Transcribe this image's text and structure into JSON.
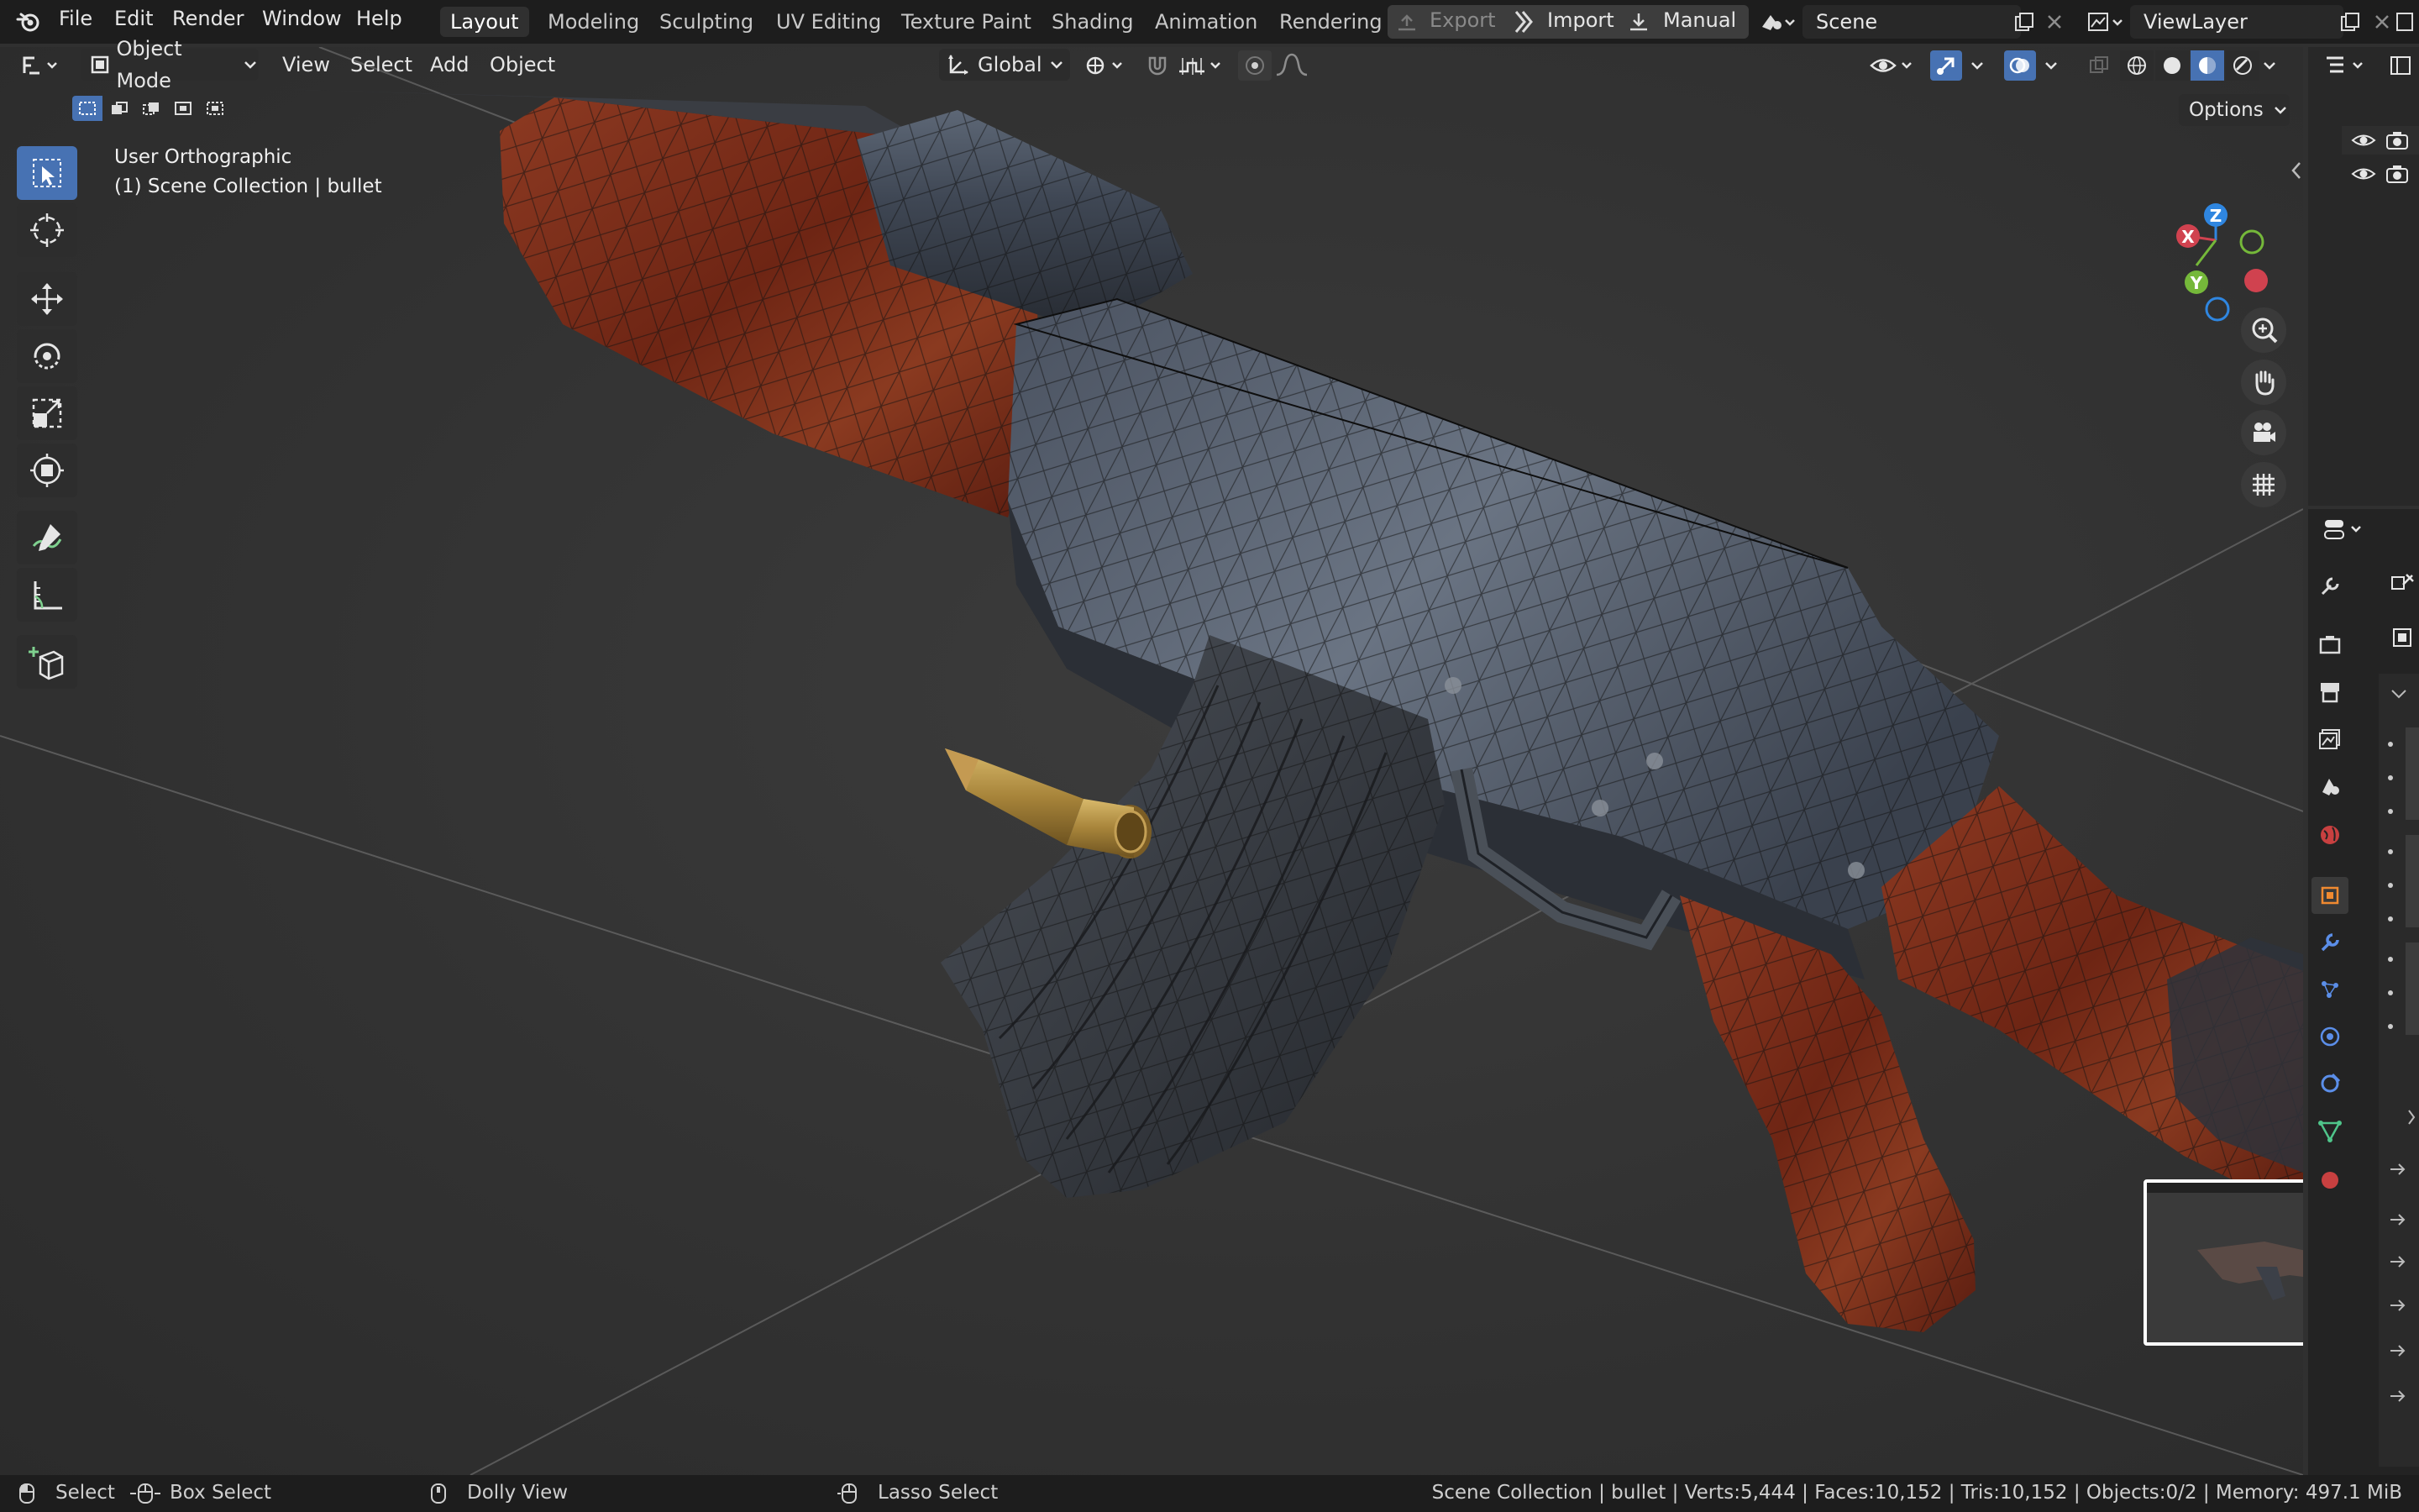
{
  "topbar": {
    "menus": [
      "File",
      "Edit",
      "Render",
      "Window",
      "Help"
    ],
    "workspaces": [
      "Layout",
      "Modeling",
      "Sculpting",
      "UV Editing",
      "Texture Paint",
      "Shading",
      "Animation",
      "Rendering"
    ],
    "active_workspace": "Layout",
    "export_label": "Export",
    "import_label": "Import",
    "manual_label": "Manual",
    "scene_name": "Scene",
    "view_layer_name": "ViewLayer"
  },
  "header": {
    "mode": "Object Mode",
    "menus": [
      "View",
      "Select",
      "Add",
      "Object"
    ],
    "orientation": "Global",
    "options_label": "Options"
  },
  "viewport": {
    "view_name": "User Orthographic",
    "collection_info": "(1) Scene Collection | bullet",
    "gizmo_axes": {
      "x": "X",
      "y": "Y",
      "z": "Z"
    }
  },
  "toolbar": {
    "tools": [
      "select-box",
      "cursor",
      "move",
      "rotate",
      "scale",
      "transform",
      "annotate",
      "measure",
      "add-cube"
    ],
    "active_tool": "select-box"
  },
  "statusbar": {
    "select": "Select",
    "box_select": "Box Select",
    "dolly_view": "Dolly View",
    "lasso_select": "Lasso Select",
    "stats": "Scene Collection | bullet | Verts:5,444 | Faces:10,152 | Tris:10,152 | Objects:0/2 | Memory: 497.1 MiB"
  },
  "colors": {
    "accent": "#4772b3",
    "axis_x": "#d0424f",
    "axis_y": "#75b83a",
    "axis_z": "#2f86e0",
    "wood": "#7a2a17",
    "metal": "#3d4450",
    "brass": "#b08d3e"
  }
}
